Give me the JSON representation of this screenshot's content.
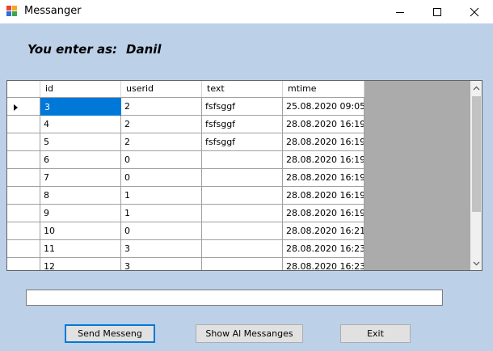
{
  "window": {
    "title": "Messanger",
    "icon": "app-window-icon"
  },
  "header": {
    "enter_label": "You enter as:",
    "user_name": "Danil"
  },
  "grid": {
    "columns": [
      "id",
      "userid",
      "text",
      "mtime"
    ],
    "current_row": 0,
    "rows": [
      {
        "id": "3",
        "userid": "2",
        "text": "fsfsggf",
        "mtime": "25.08.2020 09:05"
      },
      {
        "id": "4",
        "userid": "2",
        "text": "fsfsggf",
        "mtime": "28.08.2020 16:19"
      },
      {
        "id": "5",
        "userid": "2",
        "text": "fsfsggf",
        "mtime": "28.08.2020 16:19"
      },
      {
        "id": "6",
        "userid": "0",
        "text": "",
        "mtime": "28.08.2020 16:19"
      },
      {
        "id": "7",
        "userid": "0",
        "text": "",
        "mtime": "28.08.2020 16:19"
      },
      {
        "id": "8",
        "userid": "1",
        "text": "",
        "mtime": "28.08.2020 16:19"
      },
      {
        "id": "9",
        "userid": "1",
        "text": "",
        "mtime": "28.08.2020 16:19"
      },
      {
        "id": "10",
        "userid": "0",
        "text": "",
        "mtime": "28.08.2020 16:21"
      },
      {
        "id": "11",
        "userid": "3",
        "text": "",
        "mtime": "28.08.2020 16:23"
      },
      {
        "id": "12",
        "userid": "3",
        "text": "",
        "mtime": "28.08.2020 16:23"
      }
    ]
  },
  "message_input": {
    "value": ""
  },
  "buttons": {
    "send": "Send Messeng",
    "show_all": "Show Al Messanges",
    "exit": "Exit"
  },
  "colors": {
    "form_bg": "#bcd0e8",
    "selection": "#0078d7",
    "grid_bg": "#ababab"
  }
}
